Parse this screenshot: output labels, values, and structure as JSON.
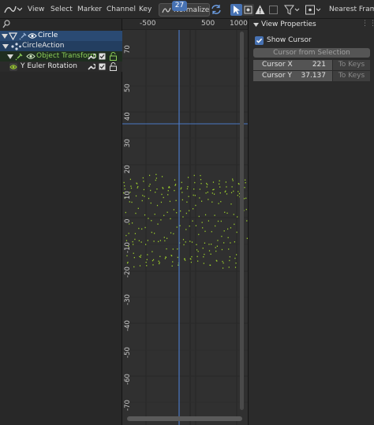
{
  "header": {
    "menus": [
      "View",
      "Select",
      "Marker",
      "Channel",
      "Key"
    ],
    "normalize_label": "Normalize",
    "interpolation_label": "Nearest Frame"
  },
  "channels": {
    "object_label": "Circle",
    "action_label": "CircleAction",
    "group_label": "Object Transform",
    "channel_label": "Y Euler Rotation"
  },
  "ruler": {
    "frame_labels": [
      "-500",
      "500",
      "1000"
    ],
    "current_frame": "27"
  },
  "y_axis": {
    "labels": [
      "70",
      "50",
      "40",
      "30",
      "20",
      "10",
      "0",
      "-10",
      "-20",
      "-30",
      "-40",
      "-50",
      "-60",
      "-70"
    ]
  },
  "sidebar": {
    "panel_title": "View Properties",
    "show_cursor_label": "Show Cursor",
    "show_cursor_checked": true,
    "cursor_from_selection_label": "Cursor from Selection",
    "cursor_x_label": "Cursor X",
    "cursor_x_value": "221",
    "cursor_y_label": "Cursor Y",
    "cursor_y_value": "37.137",
    "to_keys_label": "To Keys"
  },
  "colors": {
    "accent": "#4772b3",
    "curve": "#9ed02c",
    "cursor_line": "#4a78c4"
  },
  "icons": {
    "editor_type": "graph-editor-icon",
    "normalize": "normalize-icon",
    "refresh": "refresh-icon",
    "pivot": "pivot-icon",
    "filter": "filter-icon",
    "snap": "snap-icon",
    "object": "object-icon",
    "visibility": "eye-icon",
    "wrench": "wrench-icon",
    "lock": "lock-icon"
  }
}
